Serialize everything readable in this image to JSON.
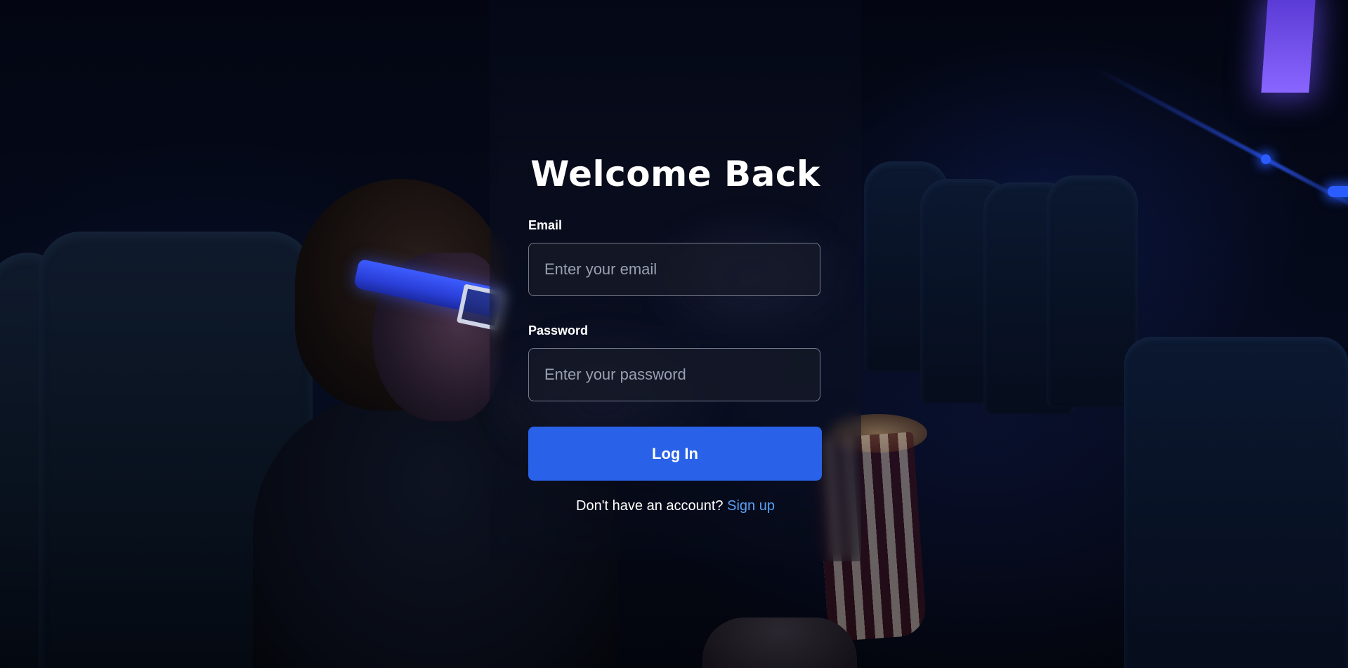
{
  "login": {
    "title": "Welcome Back",
    "email_label": "Email",
    "email_placeholder": "Enter your email",
    "email_value": "",
    "password_label": "Password",
    "password_placeholder": "Enter your password",
    "password_value": "",
    "submit_label": "Log In",
    "signup_prompt": "Don't have an account?",
    "signup_link": "Sign up"
  },
  "colors": {
    "primary_button": "#2962e8",
    "link": "#5aa0f5",
    "title_text": "#ffffff",
    "background": "#02040c"
  },
  "background_image": {
    "icon": "cinema-audience-photo"
  }
}
